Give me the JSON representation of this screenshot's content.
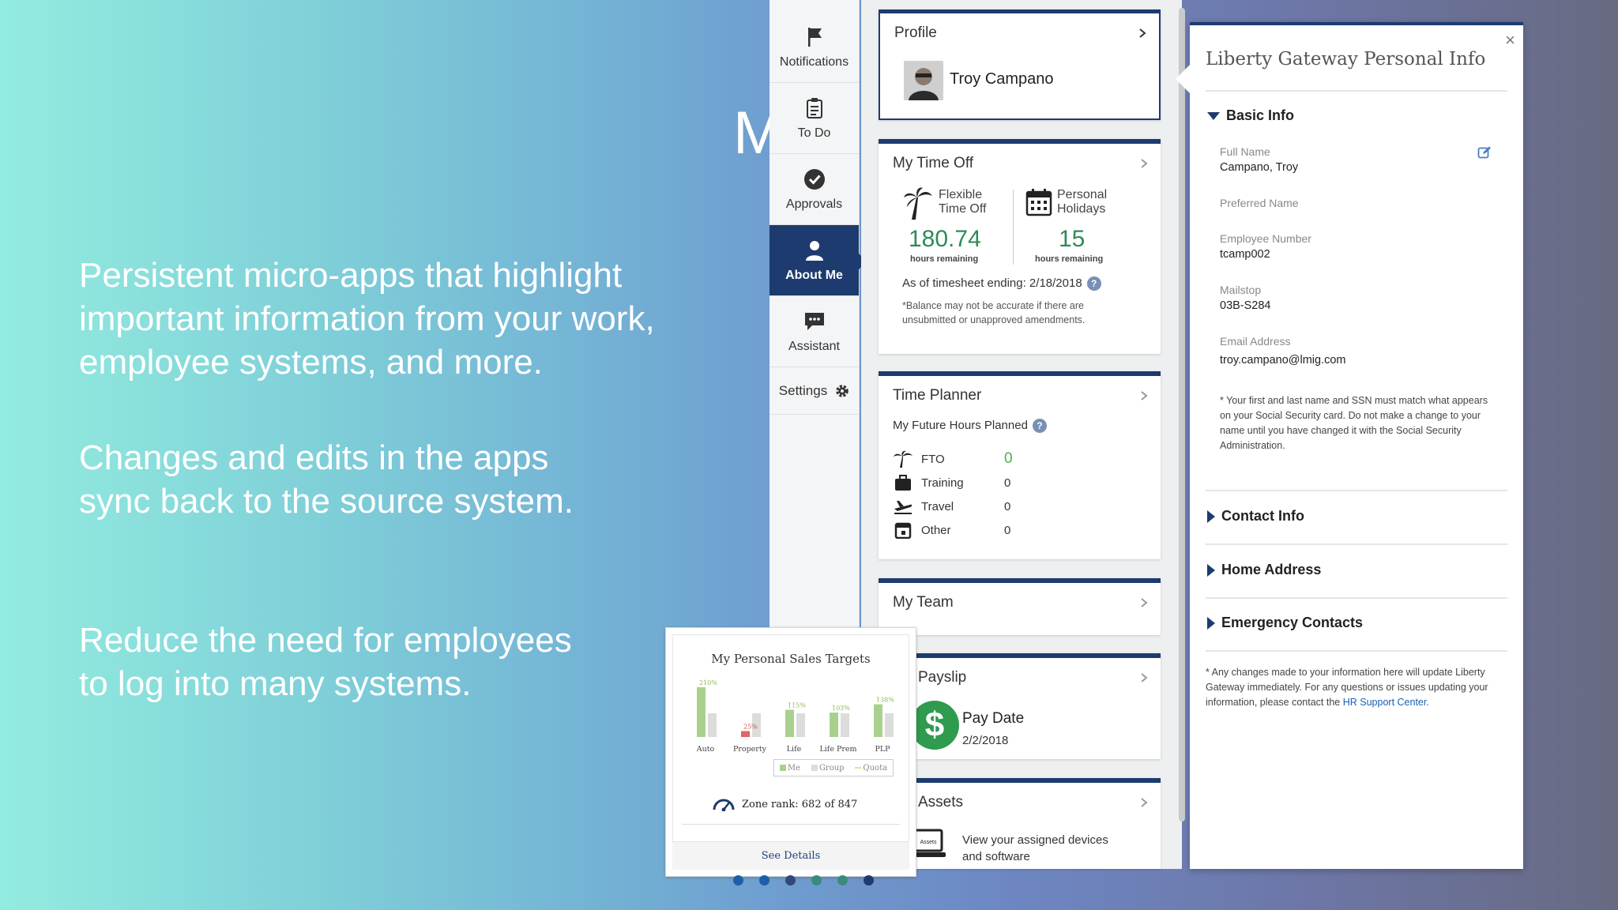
{
  "slide": {
    "partial_heading": "M",
    "bullets": [
      "Persistent micro-apps that highlight important information from your work, employee systems, and more.",
      "Changes and edits in the apps sync back to the source system.",
      "Reduce the need for employees to log into many systems."
    ]
  },
  "sidebar": {
    "items": [
      {
        "label": "Notifications",
        "icon": "flag-icon"
      },
      {
        "label": "To Do",
        "icon": "clipboard-icon"
      },
      {
        "label": "Approvals",
        "icon": "checkmark-circle-icon"
      },
      {
        "label": "About Me",
        "icon": "person-icon",
        "active": true
      },
      {
        "label": "Assistant",
        "icon": "chat-bubble-icon"
      }
    ],
    "settings_label": "Settings",
    "active_color": "#1d3b6e"
  },
  "cards": {
    "profile": {
      "title": "Profile",
      "name": "Troy Campano"
    },
    "timeoff": {
      "title": "My Time Off",
      "flexible": {
        "label_line1": "Flexible",
        "label_line2": "Time Off",
        "value": "180.74",
        "sub": "hours remaining"
      },
      "personal": {
        "label_line1": "Personal",
        "label_line2": "Holidays",
        "value": "15",
        "sub": "hours remaining"
      },
      "as_of": "As of timesheet ending: 2/18/2018",
      "note": "*Balance may not be accurate if there are unsubmitted or unapproved amendments.",
      "value_color": "#2e8b57"
    },
    "planner": {
      "title": "Time Planner",
      "subheading": "My Future Hours Planned",
      "rows": [
        {
          "label": "FTO",
          "value": "0",
          "icon": "palm-tree-icon"
        },
        {
          "label": "Training",
          "value": "0",
          "icon": "briefcase-icon"
        },
        {
          "label": "Travel",
          "value": "0",
          "icon": "airplane-icon"
        },
        {
          "label": "Other",
          "value": "0",
          "icon": "calendar-icon"
        }
      ]
    },
    "team": {
      "title": "My Team"
    },
    "payslip": {
      "title": "Payslip",
      "pay_date_label": "Pay Date",
      "pay_date": "2/2/2018"
    },
    "assets": {
      "title": "Assets",
      "icon_text": "Assets",
      "text_line1": "View your assigned devices",
      "text_line2": "and software"
    }
  },
  "popover": {
    "title": "Liberty Gateway Personal Info",
    "close": "×",
    "basic_info": "Basic Info",
    "fields": [
      {
        "label": "Full Name",
        "value": "Campano, Troy"
      },
      {
        "label": "Preferred Name",
        "value": ""
      },
      {
        "label": "Employee Number",
        "value": "tcamp002"
      },
      {
        "label": "Mailstop",
        "value": "03B-S284"
      },
      {
        "label": "Email Address",
        "value": "troy.campano@lmig.com"
      }
    ],
    "ssn_note": "* Your first and last name and SSN must match what appears on your Social Security card. Do not make a change to your name until you have changed it with the Social Security Administration.",
    "sections": [
      "Contact Info",
      "Home Address",
      "Emergency Contacts"
    ],
    "footer_text": "* Any changes made to your information here will update Liberty Gateway immediately. For any questions or issues updating your information, please contact the",
    "footer_link": "HR Support Center",
    "footer_end": "."
  },
  "sales": {
    "title": "My Personal Sales Targets",
    "legend": [
      "Me",
      "Group",
      "Quota"
    ],
    "zone_rank": "Zone rank: 682 of 847",
    "see_details": "See Details",
    "chart_data": {
      "type": "bar",
      "categories": [
        "Auto",
        "Property",
        "Life",
        "Life Prem",
        "PLP"
      ],
      "series": [
        {
          "name": "Me",
          "values": [
            210,
            25,
            115,
            103,
            138
          ],
          "labels": [
            "210%",
            "25%",
            "115%",
            "103%",
            "138%"
          ]
        },
        {
          "name": "Group",
          "values": [
            100,
            100,
            100,
            100,
            100
          ]
        }
      ],
      "colors": {
        "me": "#a9d18e",
        "me_low": "#e06666",
        "group": "#dcdcdc",
        "label_me": "#8bbf4d",
        "label_low": "#d9534f"
      }
    }
  },
  "pager": {
    "dots": [
      "#1d5fa8",
      "#1d5fa8",
      "#2f4a7a",
      "#3a8a7e",
      "#3a8a7e",
      "#1d3b6e"
    ]
  }
}
